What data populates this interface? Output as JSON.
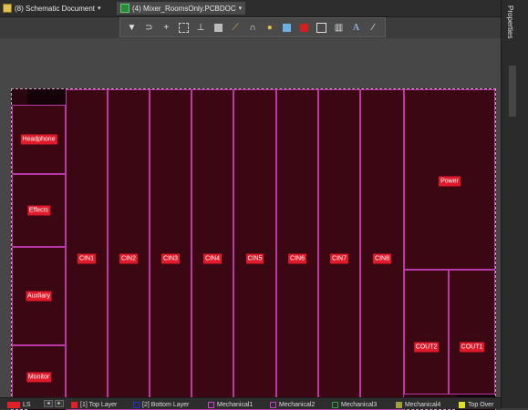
{
  "tabs": [
    {
      "label": "(8) Schematic Document",
      "caret": "▾"
    },
    {
      "label": "(4) Mixer_RoomsOnly.PCBDOC",
      "caret": "▾"
    }
  ],
  "properties_panel": {
    "label": "Properties"
  },
  "toolbar_icons": [
    "filter-icon",
    "route-icon",
    "plus-icon",
    "select-icon",
    "chart-icon",
    "component-icon",
    "polygon-icon",
    "arc-icon",
    "pin-icon",
    "pad-icon",
    "keepout-icon",
    "region-icon",
    "measure-icon",
    "text-icon",
    "line-icon"
  ],
  "board_regions": {
    "left": [
      {
        "label": "Headphone"
      },
      {
        "label": "Effects"
      },
      {
        "label": "Auxliary"
      },
      {
        "label": "Monitor"
      }
    ],
    "channels": [
      {
        "label": "CIN1"
      },
      {
        "label": "CIN2"
      },
      {
        "label": "CIN3"
      },
      {
        "label": "CIN4"
      },
      {
        "label": "CIN5"
      },
      {
        "label": "CIN6"
      },
      {
        "label": "CIN7"
      },
      {
        "label": "CIN8"
      }
    ],
    "power": {
      "label": "Power"
    },
    "outputs": [
      {
        "label": "COUT2"
      },
      {
        "label": "COUT1"
      }
    ]
  },
  "layers": [
    {
      "label": "LS",
      "color": "#e0202a"
    },
    {
      "label": "[1] Top Layer",
      "color": "#e0202a"
    },
    {
      "label": "[2] Bottom Layer",
      "color": "#2030e0"
    },
    {
      "label": "Mechanical1",
      "color": "#d040d0"
    },
    {
      "label": "Mechanical2",
      "color": "#c040c0"
    },
    {
      "label": "Mechanical3",
      "color": "#30a040"
    },
    {
      "label": "Mechanical4",
      "color": "#a0a040"
    },
    {
      "label": "Top Over",
      "color": "#e0e020"
    }
  ],
  "colors": {
    "board_fill": "#3a0713",
    "region_outline": "#b838a8",
    "label_fill": "#e01a2a"
  }
}
